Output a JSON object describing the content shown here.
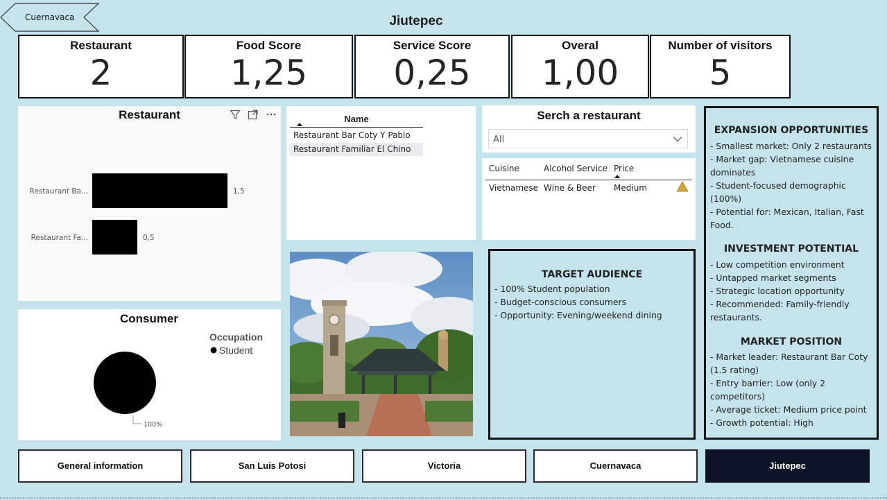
{
  "back_button": {
    "label": "Cuernavaca"
  },
  "page_title": "Jiutepec",
  "kpis": [
    {
      "label": "Restaurant",
      "value": "2"
    },
    {
      "label": "Food Score",
      "value": "1,25"
    },
    {
      "label": "Service Score",
      "value": "0,25"
    },
    {
      "label": "Overal",
      "value": "1,00"
    },
    {
      "label": "Number of visitors",
      "value": "5"
    }
  ],
  "bar_visual": {
    "title": "Restaurant",
    "icons": [
      "filter-icon",
      "focus-mode-icon",
      "more-options-icon"
    ]
  },
  "chart_data": [
    {
      "type": "bar",
      "orientation": "horizontal",
      "title": "Restaurant",
      "categories": [
        "Restaurant Ba...",
        "Restaurant Fa..."
      ],
      "values": [
        1.5,
        0.5
      ],
      "value_labels": [
        "1,5",
        "0,5"
      ],
      "xlim": [
        0,
        1.5
      ],
      "grid": false,
      "colors": [
        "#000000"
      ]
    },
    {
      "type": "pie",
      "title": "Consumer",
      "legend_title": "Occupation",
      "legend_position": "right",
      "series": [
        {
          "name": "Student",
          "values": [
            100
          ]
        }
      ],
      "slice_labels": [
        "100%"
      ],
      "colors": [
        "#000000"
      ]
    }
  ],
  "name_table": {
    "header": "Name",
    "rows": [
      "Restaurant Bar Coty Y Pablo",
      "Restaurant Familiar El Chino"
    ]
  },
  "search": {
    "title": "Serch a restaurant",
    "selected": "All"
  },
  "detail_table": {
    "headers": [
      "Cuisine",
      "Alcohol Service",
      "Price"
    ],
    "row": [
      "Vietnamese",
      "Wine & Beer",
      "Medium"
    ],
    "warning_color": "#d4a63a"
  },
  "target_audience": {
    "heading": "TARGET AUDIENCE",
    "lines": [
      "- 100% Student population",
      "- Budget-conscious consumers",
      "- Opportunity: Evening/weekend dining"
    ]
  },
  "insights": {
    "sections": [
      {
        "heading": "EXPANSION OPPORTUNITIES",
        "lines": [
          "- Smallest market: Only 2 restaurants",
          "- Market gap: Vietnamese cuisine",
          "dominates",
          "- Student-focused demographic",
          "(100%)",
          "- Potential for: Mexican, Italian, Fast",
          "Food."
        ]
      },
      {
        "heading": "INVESTMENT POTENTIAL",
        "lines": [
          "- Low competition environment",
          "- Untapped market segments",
          "- Strategic location opportunity",
          "- Recommended: Family-friendly",
          "restaurants."
        ]
      },
      {
        "heading": "MARKET POSITION",
        "lines": [
          "- Market leader: Restaurant Bar Coty",
          "(1.5 rating)",
          "- Entry barrier: Low (only 2",
          "competitors)",
          "- Average ticket: Medium price point",
          "- Growth potential: High"
        ]
      }
    ]
  },
  "nav": [
    {
      "label": "General information"
    },
    {
      "label": "San Luis Potosi"
    },
    {
      "label": "Victoria"
    },
    {
      "label": "Cuernavaca"
    },
    {
      "label": "Jiutepec"
    }
  ],
  "theme": {
    "background": "#c4e3ea",
    "active_nav": "#0c1426"
  }
}
